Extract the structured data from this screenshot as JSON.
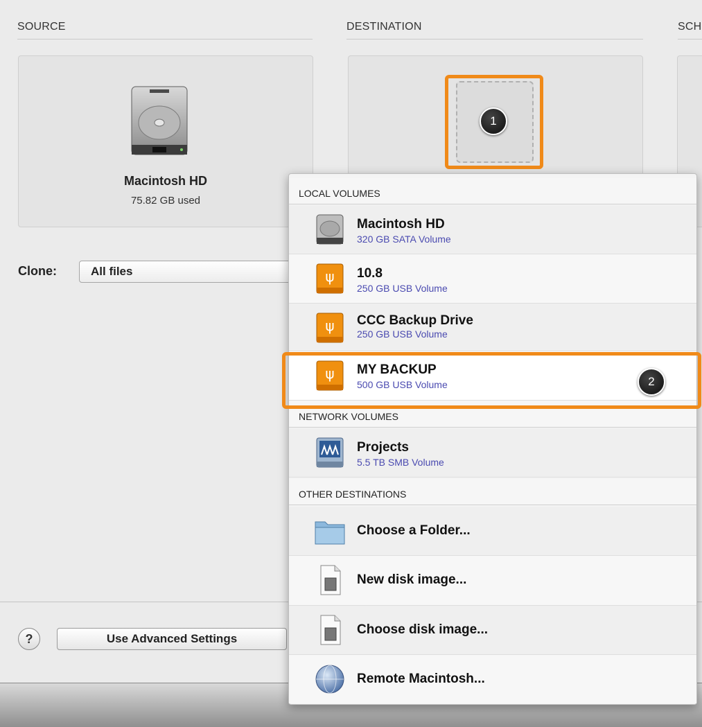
{
  "sections": {
    "source": "SOURCE",
    "destination": "DESTINATION",
    "schedule": "SCH"
  },
  "source_volume": {
    "name": "Macintosh HD",
    "used": "75.82 GB used"
  },
  "clone": {
    "label": "Clone:",
    "value": "All files"
  },
  "bottom": {
    "help": "?",
    "advanced_button": "Use Advanced Settings"
  },
  "badges": {
    "one": "1",
    "two": "2"
  },
  "menu": {
    "local_header": "LOCAL VOLUMES",
    "network_header": "NETWORK VOLUMES",
    "other_header": "OTHER DESTINATIONS",
    "local": [
      {
        "name": "Macintosh HD",
        "detail": "320 GB SATA Volume",
        "icon": "hard-drive-icon"
      },
      {
        "name": "10.8",
        "detail": "250 GB USB Volume",
        "icon": "usb-drive-icon"
      },
      {
        "name": "CCC Backup Drive",
        "detail": "250 GB USB Volume",
        "icon": "usb-drive-icon"
      },
      {
        "name": "MY BACKUP",
        "detail": "500 GB USB Volume",
        "icon": "usb-drive-icon"
      }
    ],
    "network": [
      {
        "name": "Projects",
        "detail": "5.5 TB SMB Volume",
        "icon": "network-drive-icon"
      }
    ],
    "other": [
      {
        "label": "Choose a Folder...",
        "icon": "folder-icon"
      },
      {
        "label": "New disk image...",
        "icon": "disk-image-icon"
      },
      {
        "label": "Choose disk image...",
        "icon": "disk-image-icon"
      },
      {
        "label": "Remote Macintosh...",
        "icon": "network-globe-icon"
      }
    ]
  },
  "colors": {
    "highlight": "#f08a19",
    "subtext": "#4a4ab0",
    "usb": "#f0900f"
  }
}
